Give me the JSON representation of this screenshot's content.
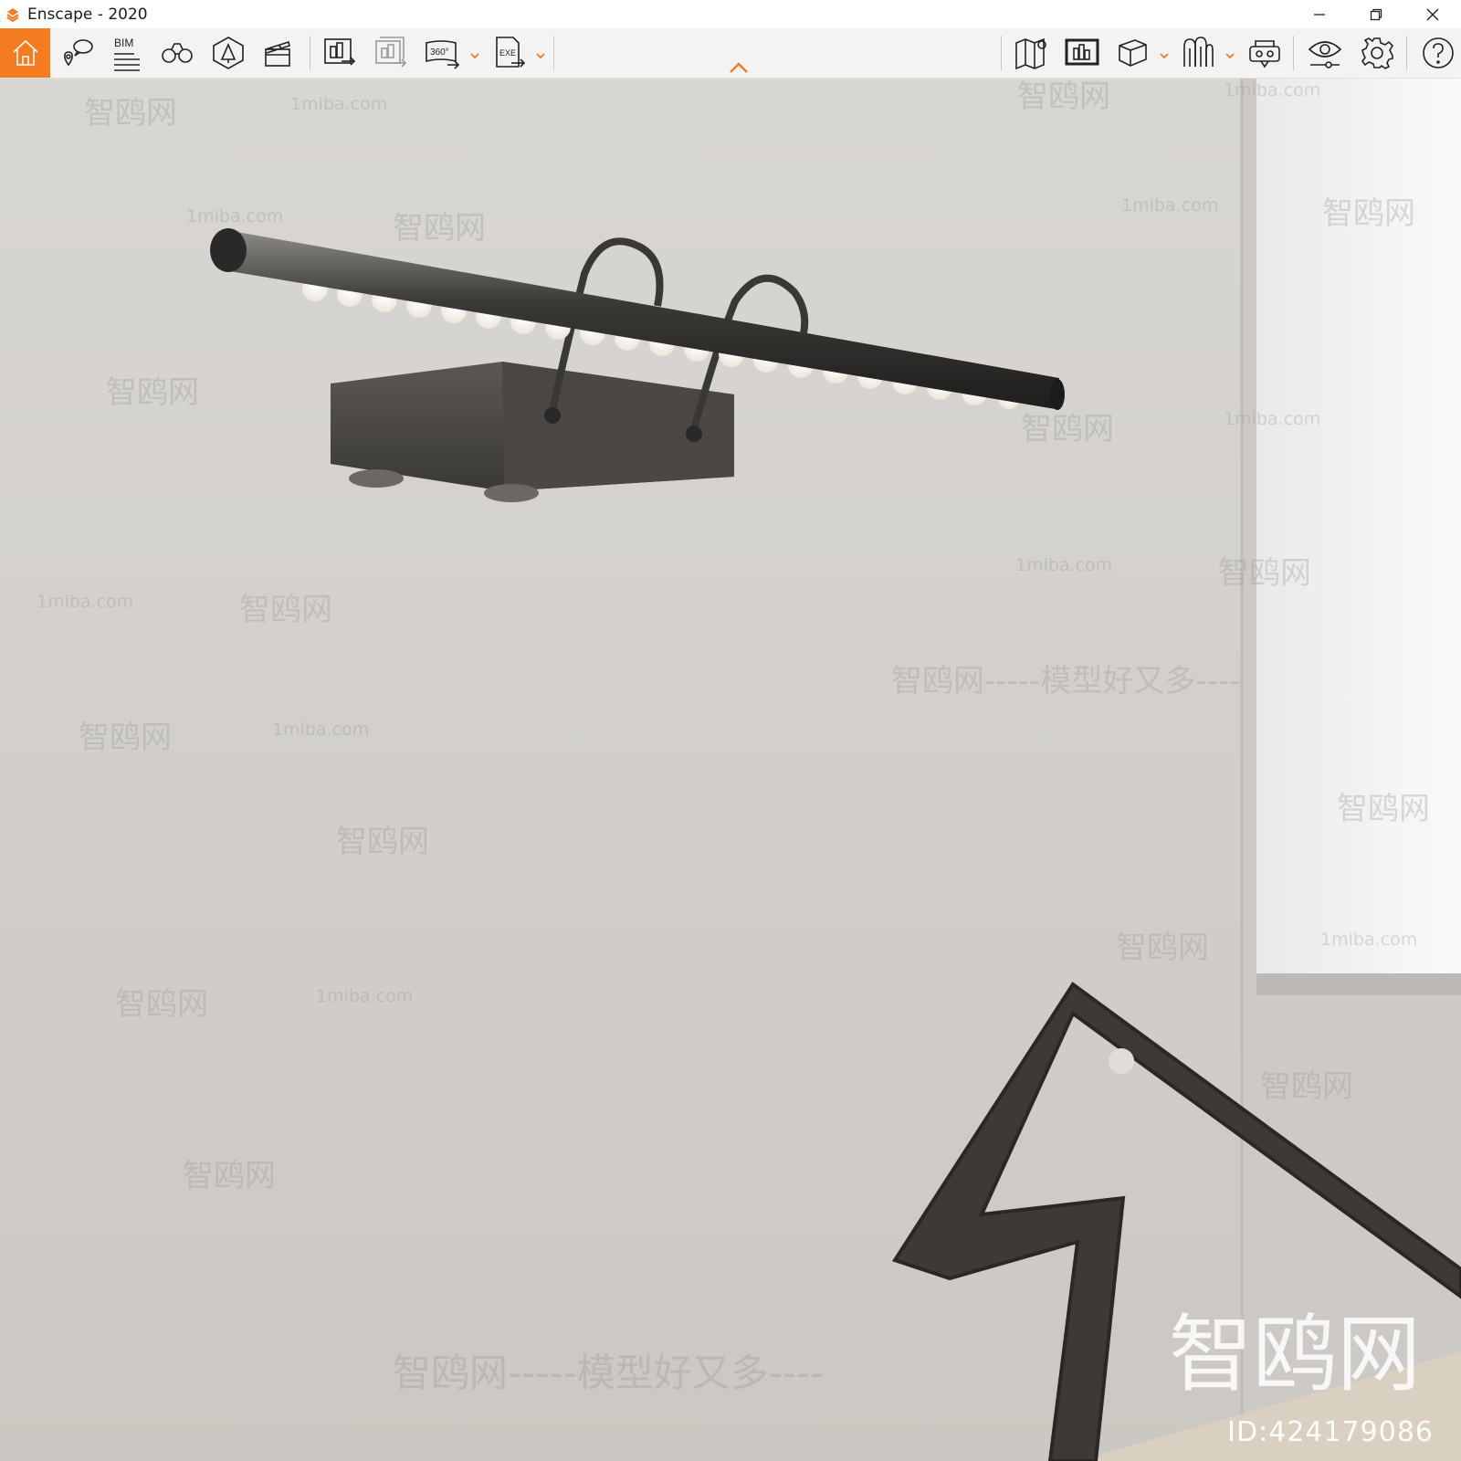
{
  "window": {
    "title": "Enscape - 2020",
    "controls": {
      "minimize": "minimize-icon",
      "restore": "restore-icon",
      "close": "close-icon"
    }
  },
  "toolbar": {
    "accent_color": "#f47b20",
    "left_buttons": [
      {
        "icon": "home-icon"
      },
      {
        "icon": "views-icon"
      },
      {
        "icon": "bim-icon",
        "label": "BIM"
      },
      {
        "icon": "binoculars-icon"
      },
      {
        "icon": "asset-library-icon"
      },
      {
        "icon": "video-editor-icon"
      },
      {
        "icon": "screenshot-export-icon"
      },
      {
        "icon": "batch-export-icon"
      },
      {
        "icon": "panorama-360-icon",
        "label": "360°"
      },
      {
        "icon": "exe-export-icon",
        "label": "EXE"
      }
    ],
    "right_buttons": [
      {
        "icon": "map-icon"
      },
      {
        "icon": "render-window-icon"
      },
      {
        "icon": "cube-icon"
      },
      {
        "icon": "atmosphere-icon"
      },
      {
        "icon": "vr-headset-icon"
      },
      {
        "icon": "visual-settings-icon"
      },
      {
        "icon": "settings-gear-icon"
      },
      {
        "icon": "help-icon"
      }
    ]
  },
  "viewport": {
    "watermarks": {
      "site": "1miba.com",
      "brand": "智鸥网",
      "slogan": "智鸥网-----模型好又多----",
      "dashes": "------"
    },
    "brand_corner": "智鸥网",
    "id_text": "ID:424179086"
  }
}
